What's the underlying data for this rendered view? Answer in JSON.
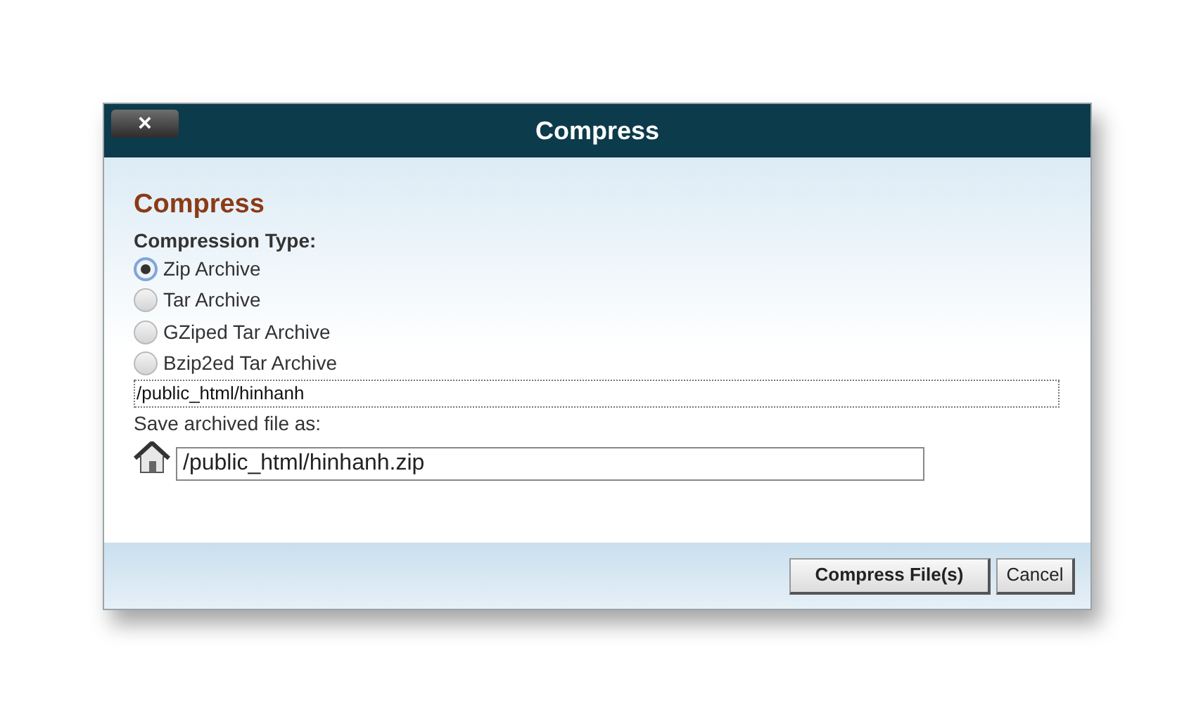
{
  "window": {
    "title": "Compress",
    "close": "×"
  },
  "heading": "Compress",
  "compression_type": {
    "label": "Compression Type:",
    "options": [
      {
        "label": "Zip Archive",
        "selected": true
      },
      {
        "label": "Tar Archive",
        "selected": false
      },
      {
        "label": "GZiped Tar Archive",
        "selected": false
      },
      {
        "label": "Bzip2ed Tar Archive",
        "selected": false
      }
    ]
  },
  "files": "/public_html/hinhanh",
  "save_as": {
    "label": "Save archived file as:",
    "value": "/public_html/hinhanh.zip"
  },
  "buttons": [
    {
      "label": "Compress File(s)",
      "kind": "primary"
    },
    {
      "label": "Cancel",
      "kind": "secondary"
    }
  ]
}
